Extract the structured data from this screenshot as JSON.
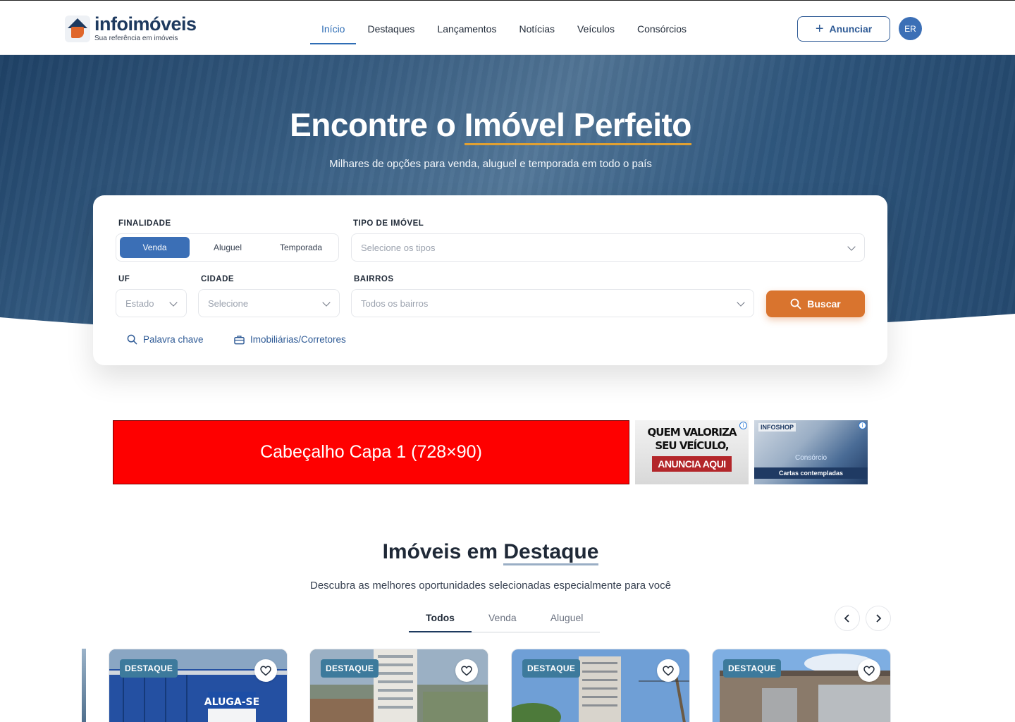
{
  "header": {
    "logo_name": "infoimóveis",
    "logo_tagline": "Sua referência em imóveis",
    "nav": [
      "Início",
      "Destaques",
      "Lançamentos",
      "Notícias",
      "Veículos",
      "Consórcios"
    ],
    "active_nav": "Início",
    "anunciar_label": "Anunciar",
    "avatar_initials": "ER"
  },
  "hero": {
    "title_part1": "Encontre o ",
    "title_highlight": "Imóvel Perfeito",
    "subtitle": "Milhares de opções para venda, aluguel e temporada em todo o país"
  },
  "search": {
    "finalidade_label": "FINALIDADE",
    "finalidade_options": [
      "Venda",
      "Aluguel",
      "Temporada"
    ],
    "finalidade_selected": "Venda",
    "tipo_label": "TIPO DE IMÓVEL",
    "tipo_placeholder": "Selecione os tipos",
    "uf_label": "UF",
    "uf_placeholder": "Estado",
    "cidade_label": "CIDADE",
    "cidade_placeholder": "Selecione",
    "bairros_label": "BAIRROS",
    "bairros_placeholder": "Todos os bairros",
    "buscar_label": "Buscar",
    "link_keyword": "Palavra chave",
    "link_agencies": "Imobiliárias/Corretores"
  },
  "ads": {
    "main_text": "Cabeçalho Capa 1 (728×90)",
    "small1_line1": "QUEM VALORIZA",
    "small1_line2": "SEU VEÍCULO,",
    "small1_cta": "ANUNCIA AQUI",
    "small2_brand": "INFOSHOP",
    "small2_line1": "Consórcio",
    "small2_line2": "Cartas contempladas"
  },
  "featured": {
    "title_part1": "Imóveis em ",
    "title_highlight": "Destaque",
    "subtitle": "Descubra as melhores oportunidades selecionadas especialmente para você",
    "tabs": [
      "Todos",
      "Venda",
      "Aluguel"
    ],
    "active_tab": "Todos",
    "cards": [
      {
        "badge": "DESTAQUE"
      },
      {
        "badge": "DESTAQUE"
      },
      {
        "badge": "DESTAQUE"
      },
      {
        "badge": "DESTAQUE"
      }
    ]
  },
  "colors": {
    "brand_blue": "#2f5b96",
    "accent_orange": "#d9742e",
    "badge_teal": "#3d7a9c",
    "ad_red": "#fe0000"
  }
}
